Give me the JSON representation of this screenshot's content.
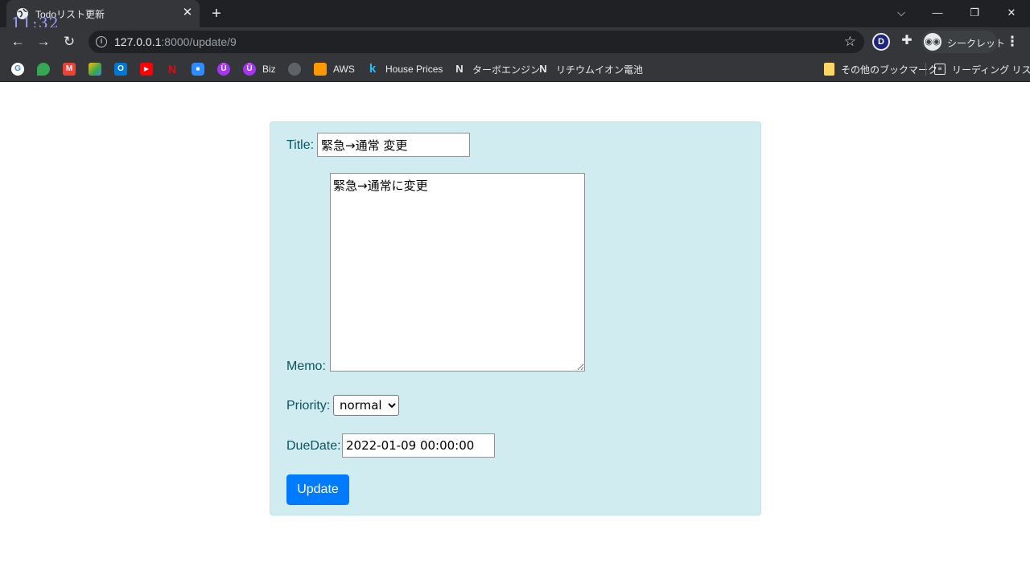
{
  "browser": {
    "tab_title": "Todoリスト更新",
    "clock": "11:32",
    "url_host": "127.0.0.1",
    "url_path": ":8000/update/9",
    "incognito_label": "シークレット",
    "extension_letter": "D",
    "window_controls": {
      "tab_search": "⌵",
      "minimize": "—",
      "restore": "❐",
      "close": "✕"
    },
    "bookmarks": [
      {
        "label": "",
        "icon": "google-icon",
        "color": "#ffffff"
      },
      {
        "label": "",
        "icon": "maps-icon",
        "color": "#34a853"
      },
      {
        "label": "",
        "icon": "gmail-icon",
        "color": "#ea4335"
      },
      {
        "label": "",
        "icon": "drive-icon",
        "color": "#fbbc04"
      },
      {
        "label": "",
        "icon": "outlook-icon",
        "color": "#0078d4"
      },
      {
        "label": "",
        "icon": "youtube-icon",
        "color": "#ff0000"
      },
      {
        "label": "",
        "icon": "netflix-icon",
        "color": "#e50914"
      },
      {
        "label": "",
        "icon": "zoom-icon",
        "color": "#2d8cff"
      },
      {
        "label": "",
        "icon": "udemy-icon",
        "color": "#a435f0"
      },
      {
        "label": "Biz",
        "icon": "udemy-business-icon",
        "color": "#a435f0"
      },
      {
        "label": "",
        "icon": "github-icon",
        "color": "#5f6368"
      },
      {
        "label": "AWS",
        "icon": "aws-icon",
        "color": "#ff9900"
      },
      {
        "label": "House Prices",
        "icon": "kaggle-icon",
        "color": "#20beff"
      },
      {
        "label": "ターボエンジン",
        "icon": "notion-like-icon",
        "color": "#ffffff"
      },
      {
        "label": "リチウムイオン電池",
        "icon": "notion-like-icon",
        "color": "#ffffff"
      }
    ],
    "other_bookmarks": "その他のブックマーク",
    "reading_list": "リーディング リスト"
  },
  "form": {
    "title_label": "Title:",
    "title_value": "緊急→通常 変更",
    "memo_label": "Memo:",
    "memo_value": "緊急→通常に変更",
    "priority_label": "Priority:",
    "priority_selected": "normal",
    "duedate_label": "DueDate:",
    "duedate_value": "2022-01-09 00:00:00",
    "submit_label": "Update"
  },
  "colors": {
    "card_bg": "#d1ecf1",
    "label_text": "#0c5460",
    "button_bg": "#007bff"
  }
}
